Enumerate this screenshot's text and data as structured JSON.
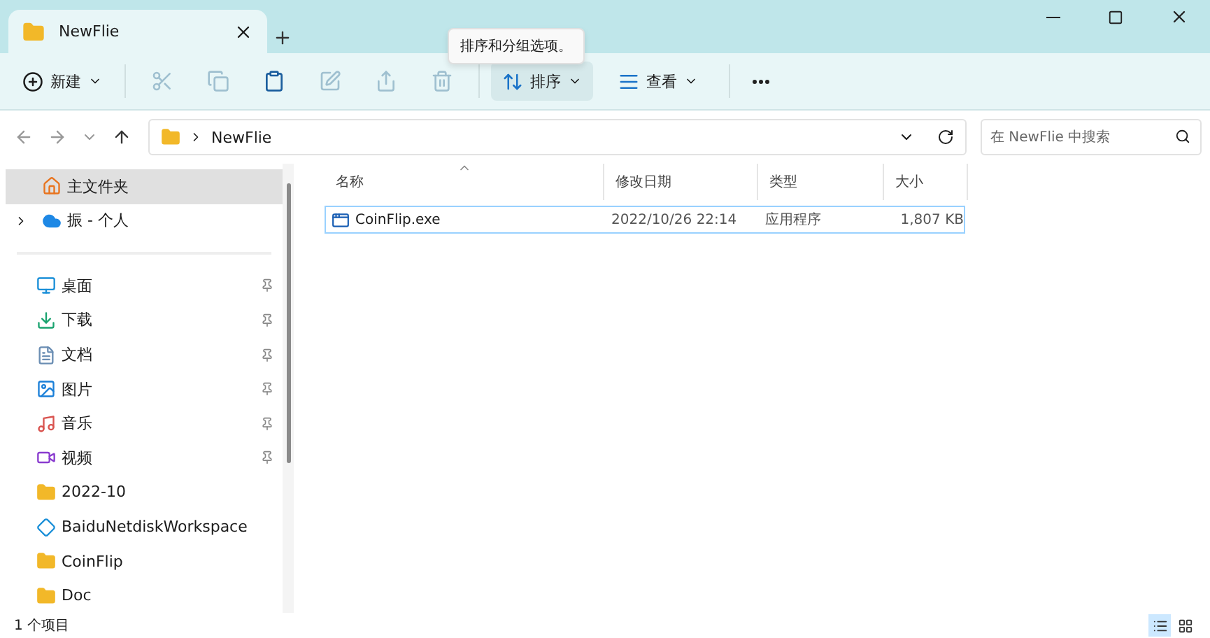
{
  "tabs": [
    {
      "label": "NewFlie",
      "selected": true
    }
  ],
  "toolbar": {
    "new_button": {
      "label": "新建"
    },
    "actions": [
      {
        "kind": "cut",
        "disabled": true
      },
      {
        "kind": "copy",
        "disabled": true
      },
      {
        "kind": "paste",
        "disabled": false
      },
      {
        "kind": "rename",
        "disabled": true
      },
      {
        "kind": "share",
        "disabled": true
      },
      {
        "kind": "delete",
        "disabled": true
      }
    ],
    "menus": [
      {
        "kind": "sort",
        "label": "排序",
        "selected": true
      },
      {
        "kind": "view",
        "label": "查看",
        "selected": false
      }
    ],
    "tooltip": "排序和分组选项。"
  },
  "address": {
    "breadcrumb": [
      "NewFlie"
    ],
    "search_placeholder": "在 NewFlie 中搜索"
  },
  "sidebar": {
    "top_items": [
      {
        "kind": "home",
        "label": "主文件夹",
        "selected": true,
        "expandable": false
      },
      {
        "kind": "cloud",
        "label": "振 - 个人",
        "selected": false,
        "expandable": true
      }
    ],
    "quick_access": [
      {
        "kind": "desktop",
        "label": "桌面",
        "pinned": true
      },
      {
        "kind": "download",
        "label": "下载",
        "pinned": true
      },
      {
        "kind": "document",
        "label": "文档",
        "pinned": true
      },
      {
        "kind": "picture",
        "label": "图片",
        "pinned": true
      },
      {
        "kind": "music",
        "label": "音乐",
        "pinned": true
      },
      {
        "kind": "video",
        "label": "视频",
        "pinned": true
      },
      {
        "kind": "folder",
        "label": "2022-10",
        "pinned": false
      },
      {
        "kind": "netdisk",
        "label": "BaiduNetdiskWorkspace",
        "pinned": false
      },
      {
        "kind": "folder",
        "label": "CoinFlip",
        "pinned": false
      },
      {
        "kind": "folder",
        "label": "Doc",
        "pinned": false
      }
    ]
  },
  "table": {
    "columns": [
      {
        "label": "名称",
        "sorted": true
      },
      {
        "label": "修改日期",
        "sorted": false
      },
      {
        "label": "类型",
        "sorted": false
      },
      {
        "label": "大小",
        "sorted": false
      }
    ],
    "rows": [
      {
        "name": "CoinFlip.exe",
        "modified": "2022/10/26 22:14",
        "type": "应用程序",
        "size": "1,807 KB",
        "selected": true
      }
    ]
  },
  "status_bar": {
    "count": "1 个项目",
    "views": [
      {
        "kind": "details",
        "selected": true
      },
      {
        "kind": "tiles",
        "selected": false
      }
    ]
  }
}
